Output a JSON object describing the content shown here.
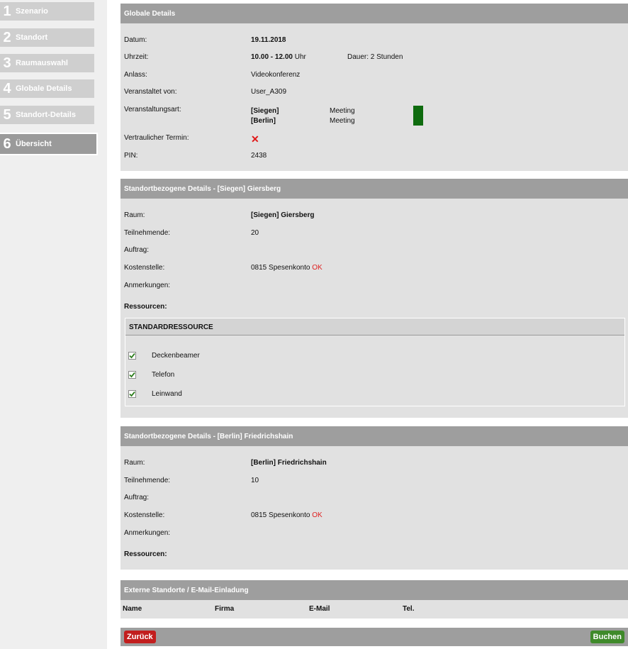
{
  "sidebar": {
    "steps": [
      {
        "num": "1",
        "label": "Szenario"
      },
      {
        "num": "2",
        "label": "Standort"
      },
      {
        "num": "3",
        "label": "Raumauswahl"
      },
      {
        "num": "4",
        "label": "Globale Details"
      },
      {
        "num": "5",
        "label": "Standort-Details"
      },
      {
        "num": "6",
        "label": "Übersicht"
      }
    ],
    "active_step": "6"
  },
  "global": {
    "title": "Globale Details",
    "datum_label": "Datum:",
    "datum": "19.11.2018",
    "uhrzeit_label": "Uhrzeit:",
    "uhrzeit": "10.00 - 12.00",
    "uhr": "Uhr",
    "dauer_label": "Dauer:",
    "dauer": "2 Stunden",
    "anlass_label": "Anlass:",
    "anlass": "Videokonferenz",
    "veranstaltet_label": "Veranstaltet von:",
    "veranstaltet": "User_A309",
    "art_label": "Veranstaltungsart:",
    "art": [
      {
        "site": "[Siegen]",
        "type": "Meeting"
      },
      {
        "site": "[Berlin]",
        "type": "Meeting"
      }
    ],
    "vertraulich_label": "Vertraulicher Termin:",
    "pin_label": "PIN:",
    "pin": "2438",
    "status_color": "#0e6b0e"
  },
  "siegen": {
    "title": "Standortbezogene Details  -  [Siegen] Giersberg",
    "raum_label": "Raum:",
    "raum": "[Siegen] Giersberg",
    "teilnehmende_label": "Teilnehmende:",
    "teilnehmende": "20",
    "auftrag_label": "Auftrag:",
    "kostenstelle_label": "Kostenstelle:",
    "kostenstelle": "0815 Spesenkonto",
    "kostenstelle_status": "OK",
    "anmerkungen_label": "Anmerkungen:",
    "ressourcen_label": "Ressourcen:",
    "ressourcen_group": "STANDARDRESSOURCE",
    "ressourcen": [
      "Deckenbeamer",
      "Telefon",
      "Leinwand"
    ]
  },
  "berlin": {
    "title": "Standortbezogene Details  -  [Berlin] Friedrichshain",
    "raum_label": "Raum:",
    "raum": "[Berlin] Friedrichshain",
    "teilnehmende_label": "Teilnehmende:",
    "teilnehmende": "10",
    "auftrag_label": "Auftrag:",
    "kostenstelle_label": "Kostenstelle:",
    "kostenstelle": "0815 Spesenkonto",
    "kostenstelle_status": "OK",
    "anmerkungen_label": "Anmerkungen:",
    "ressourcen_label": "Ressourcen:"
  },
  "extern": {
    "title": "Externe Standorte / E-Mail-Einladung",
    "columns": [
      "Name",
      "Firma",
      "E-Mail",
      "Tel."
    ]
  },
  "footer": {
    "back_label": "Zurück",
    "book_label": "Buchen"
  }
}
